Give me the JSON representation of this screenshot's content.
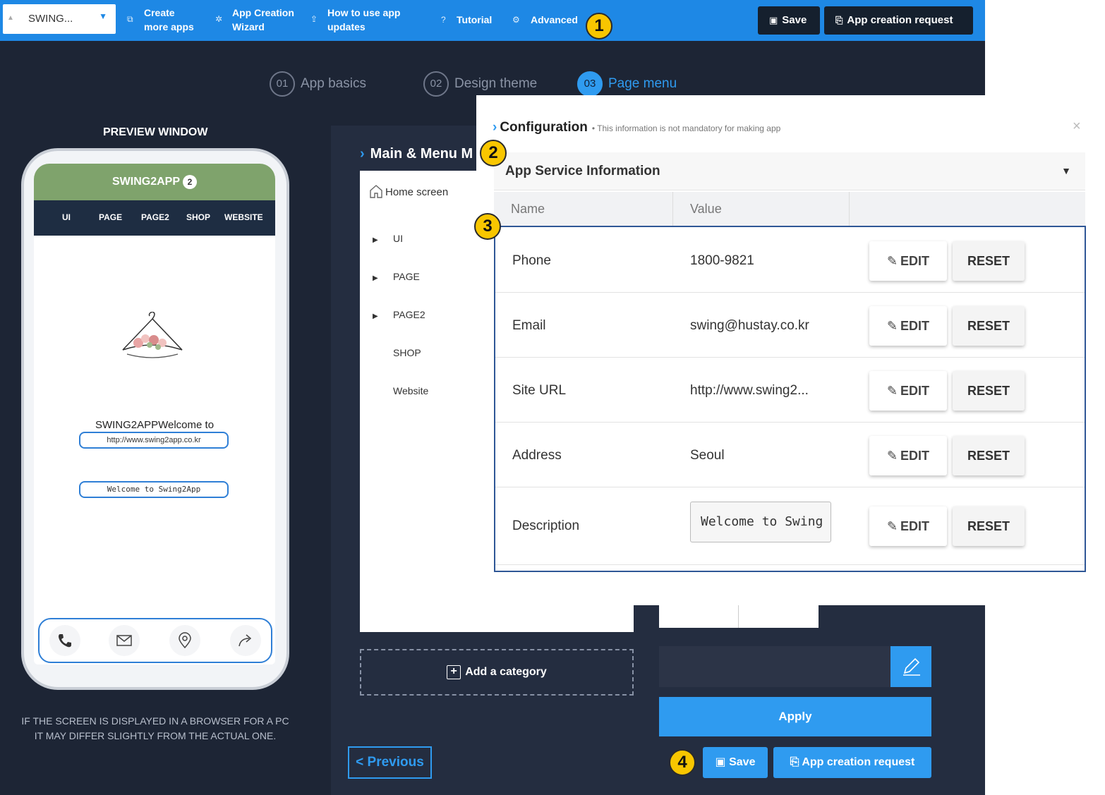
{
  "topbar": {
    "app_name": "SWING...",
    "items": [
      {
        "icon": "create-apps-icon",
        "line1": "Create",
        "line2": "more apps"
      },
      {
        "icon": "wizard-icon",
        "line1": "App Creation",
        "line2": "Wizard"
      },
      {
        "icon": "upload-icon",
        "line1": "How to use app",
        "line2": "updates"
      }
    ],
    "tutorial": "Tutorial",
    "advanced": "Advanced",
    "save": "Save",
    "app_request": "App creation request"
  },
  "steps": [
    {
      "num": "01",
      "label": "App basics"
    },
    {
      "num": "02",
      "label": "Design theme"
    },
    {
      "num": "03",
      "label": "Page menu"
    }
  ],
  "badges": [
    "1",
    "2",
    "3",
    "4"
  ],
  "preview": {
    "title": "PREVIEW WINDOW",
    "app_header": "SWING2APP",
    "app_header_badge": "2",
    "nav": [
      "UI",
      "PAGE",
      "PAGE2",
      "SHOP",
      "WEBSITE"
    ],
    "welcome": "SWING2APPWelcome to",
    "url_pill": "http://www.swing2app.co.kr",
    "desc_pill": "Welcome to Swing2App",
    "note_line1": "IF THE SCREEN IS DISPLAYED IN A BROWSER FOR A PC",
    "note_line2": "IT MAY DIFFER SLIGHTLY FROM THE ACTUAL ONE."
  },
  "main_menu": {
    "title": "Main & Menu M",
    "home": "Home screen",
    "nodes": [
      {
        "label": "UI",
        "expandable": true
      },
      {
        "label": "PAGE",
        "expandable": true
      },
      {
        "label": "PAGE2",
        "expandable": true
      },
      {
        "label": "SHOP",
        "expandable": false
      },
      {
        "label": "Website",
        "expandable": false
      }
    ],
    "add_category": "Add a category",
    "previous": "< Previous",
    "apply": "Apply",
    "save": "Save",
    "app_request": "App creation request"
  },
  "config": {
    "title": "Configuration",
    "note": "• This information is not mandatory for making app",
    "close": "×",
    "section": "App Service Information",
    "col_name": "Name",
    "col_value": "Value",
    "edit_label": "EDIT",
    "reset_label": "RESET",
    "rows": [
      {
        "name": "Phone",
        "value": "1800-9821"
      },
      {
        "name": "Email",
        "value": "swing@hustay.co.kr"
      },
      {
        "name": "Site URL",
        "value": "http://www.swing2..."
      },
      {
        "name": "Address",
        "value": "Seoul"
      },
      {
        "name": "Description",
        "value": "Welcome to Swing"
      }
    ]
  },
  "colors": {
    "topbar": "#1e88e5",
    "dark_bg": "#1d2535",
    "accent": "#2f9bf0",
    "badge": "#f8c600",
    "phone_header": "#7fa36c"
  }
}
